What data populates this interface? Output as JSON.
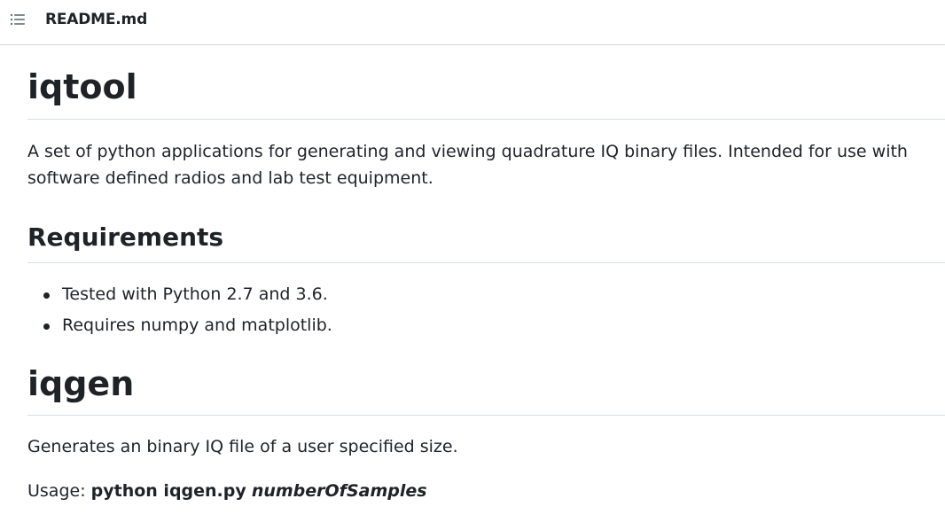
{
  "header": {
    "file_name": "README.md",
    "toc_icon": "list-unordered-icon"
  },
  "readme": {
    "title": "iqtool",
    "intro": "A set of python applications for generating and viewing quadrature IQ binary files. Intended for use with software defined radios and lab test equipment.",
    "requirements_heading": "Requirements",
    "requirements": [
      "Tested with Python 2.7 and 3.6.",
      "Requires numpy and matplotlib."
    ],
    "iqgen_heading": "iqgen",
    "iqgen_desc": "Generates an binary IQ file of a user specified size.",
    "usage_label": "Usage: ",
    "usage_command": "python iqgen.py",
    "usage_arg": "numberOfSamples"
  }
}
